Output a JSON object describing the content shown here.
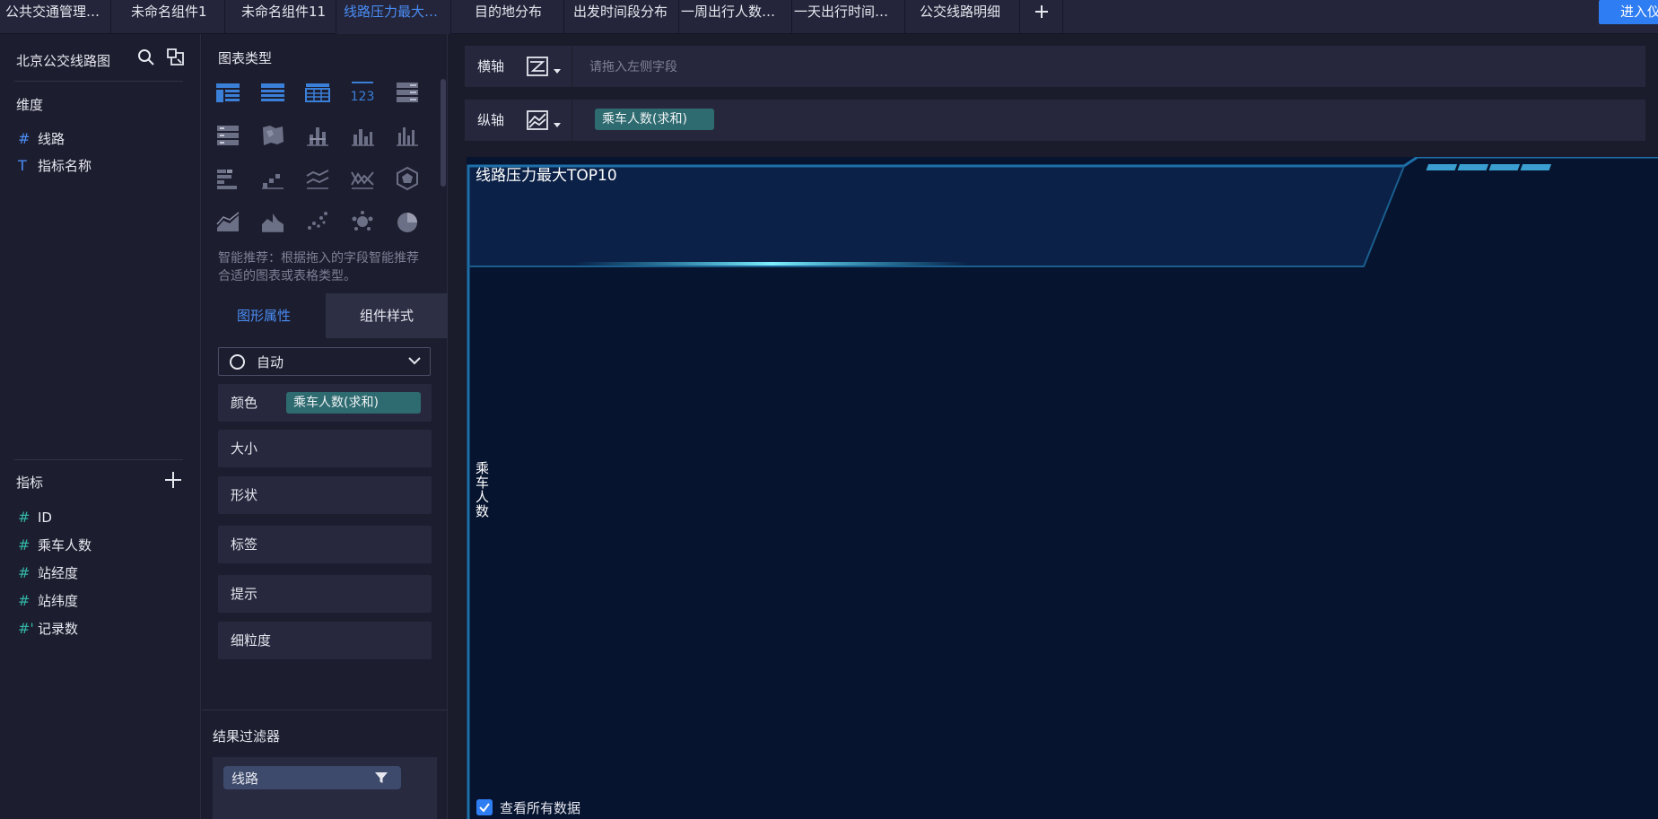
{
  "tabs": [
    {
      "label": "公共交通管理大…"
    },
    {
      "label": "未命名组件1"
    },
    {
      "label": "未命名组件11"
    },
    {
      "label": "线路压力最大T…"
    },
    {
      "label": "目的地分布"
    },
    {
      "label": "出发时间段分布"
    },
    {
      "label": "一周出行人数分布"
    },
    {
      "label": "一天出行时间分布"
    },
    {
      "label": "公交线路明细"
    }
  ],
  "enter_button": "进入仪",
  "datasource": {
    "title": "北京公交线路图"
  },
  "dimensions": {
    "label": "维度",
    "items": [
      {
        "glyph": "#",
        "name": "线路"
      },
      {
        "glyph": "T",
        "name": "指标名称"
      }
    ]
  },
  "measures": {
    "label": "指标",
    "items": [
      {
        "glyph": "#",
        "name": "ID"
      },
      {
        "glyph": "#",
        "name": "乘车人数"
      },
      {
        "glyph": "#",
        "name": "站经度"
      },
      {
        "glyph": "#",
        "name": "站纬度"
      },
      {
        "glyph": "#'",
        "name": "记录数"
      }
    ]
  },
  "chart_types": {
    "label": "图表类型"
  },
  "smart_tip": "智能推荐：根据拖入的字段智能推荐合适的图表或表格类型。",
  "prop_tabs": {
    "graph": "图形属性",
    "style": "组件样式"
  },
  "mark_type": {
    "value": "自动"
  },
  "props": {
    "color": {
      "label": "颜色",
      "field": "乘车人数(求和)"
    },
    "size": "大小",
    "shape": "形状",
    "label": "标签",
    "tooltip": "提示",
    "granularity": "细粒度"
  },
  "filter": {
    "label": "结果过滤器",
    "field": "线路"
  },
  "axes": {
    "x": {
      "label": "横轴",
      "placeholder": "请拖入左侧字段"
    },
    "y": {
      "label": "纵轴",
      "field": "乘车人数(求和)"
    }
  },
  "chart": {
    "title": "线路压力最大TOP10",
    "y_axis_label": "乘车人数",
    "show_all_data": "查看所有数据"
  },
  "colors": {
    "accent": "#2f7df2",
    "pill": "#2e6b70",
    "chart_bg": "#06142f",
    "chart_border": "#1e6fa8"
  }
}
